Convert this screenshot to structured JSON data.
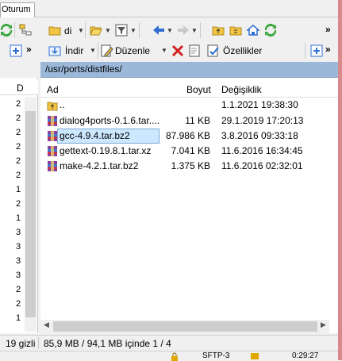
{
  "tab": {
    "label": "Oturum"
  },
  "toolbar_right_1": {
    "drive_label": "di"
  },
  "toolbar_right_2": {
    "download_label": "İndir",
    "edit_label": "Düzenle",
    "properties_label": "Özellikler"
  },
  "left_panel": {
    "column_header": "D",
    "row_digits": [
      "2",
      "2",
      "2",
      "2",
      "2",
      "2",
      "1",
      "2",
      "1",
      "3",
      "3",
      "3",
      "3",
      "2",
      "2",
      "1"
    ],
    "status": "19 gizli"
  },
  "right_panel": {
    "path": "/usr/ports/distfiles/",
    "columns": {
      "name": "Ad",
      "size": "Boyut",
      "modified": "Değişiklik"
    },
    "files": [
      {
        "name": "..",
        "size": "",
        "modified": "1.1.2021 19:38:30",
        "icon": "parent-folder-icon"
      },
      {
        "name": "dialog4ports-0.1.6.tar....",
        "size": "11 KB",
        "modified": "29.1.2019 17:20:13",
        "icon": "archive-icon"
      },
      {
        "name": "gcc-4.9.4.tar.bz2",
        "size": "87.986 KB",
        "modified": "3.8.2016 09:33:18",
        "icon": "archive-icon"
      },
      {
        "name": "gettext-0.19.8.1.tar.xz",
        "size": "7.041 KB",
        "modified": "11.6.2016 16:34:45",
        "icon": "archive-icon"
      },
      {
        "name": "make-4.2.1.tar.bz2",
        "size": "1.375 KB",
        "modified": "11.6.2016 02:32:01",
        "icon": "archive-icon"
      }
    ],
    "selected_index": 2,
    "status": "85,9 MB / 94,1 MB içinde 1 / 4"
  },
  "statusbar2": {
    "protocol": "SFTP-3",
    "time": "0:29:27"
  },
  "colors": {
    "path_bar": "#9bb8d8",
    "selection": "#cce8ff",
    "refresh_green": "#3aa83a",
    "delete_red": "#d02020",
    "nav_blue": "#2f6fd0"
  }
}
